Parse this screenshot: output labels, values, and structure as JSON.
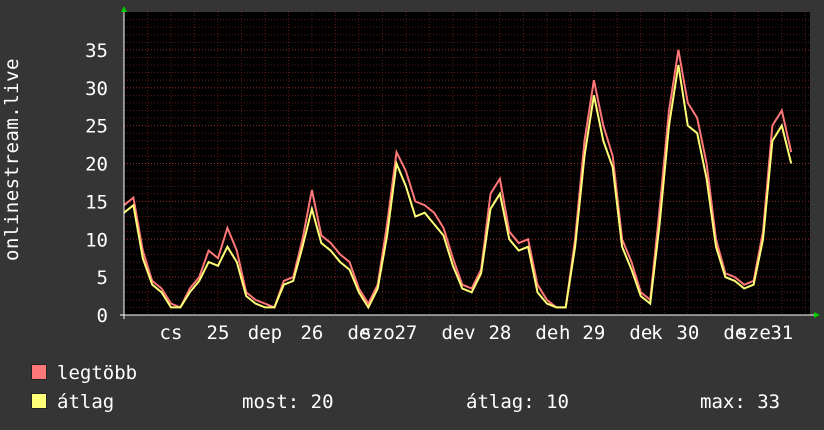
{
  "colors": {
    "background": "#353535",
    "plot_bg": "#000000",
    "max_series": "#ff7777",
    "avg_series": "#ffff77",
    "grid": "#8a2020",
    "axis": "#ffffff"
  },
  "chart_data": {
    "type": "line",
    "ylabel": "onlinestream.live",
    "ylim": [
      0,
      40
    ],
    "yticks": [
      0,
      5,
      10,
      15,
      20,
      25,
      30,
      35
    ],
    "grid": true,
    "xticks": [
      {
        "label": "cs",
        "x": 0.5
      },
      {
        "label": "25",
        "x": 1.0
      },
      {
        "label": "dep",
        "x": 1.5
      },
      {
        "label": "26",
        "x": 2.0
      },
      {
        "label": "de",
        "x": 2.5
      },
      {
        "label": "szo",
        "x": 2.7
      },
      {
        "label": "27",
        "x": 3.0
      },
      {
        "label": "de",
        "x": 3.5
      },
      {
        "label": "v",
        "x": 3.68
      },
      {
        "label": "28",
        "x": 4.0
      },
      {
        "label": "de",
        "x": 4.5
      },
      {
        "label": "h",
        "x": 4.69
      },
      {
        "label": "29",
        "x": 5.0
      },
      {
        "label": "de",
        "x": 5.5
      },
      {
        "label": "k",
        "x": 5.67
      },
      {
        "label": "30",
        "x": 6.0
      },
      {
        "label": "de",
        "x": 6.5
      },
      {
        "label": "sze",
        "x": 6.7
      },
      {
        "label": "31",
        "x": 7.0
      }
    ],
    "x": [
      0,
      0.1,
      0.2,
      0.3,
      0.4,
      0.5,
      0.6,
      0.7,
      0.8,
      0.9,
      1.0,
      1.1,
      1.2,
      1.3,
      1.4,
      1.5,
      1.6,
      1.7,
      1.8,
      1.9,
      2.0,
      2.1,
      2.2,
      2.3,
      2.4,
      2.5,
      2.6,
      2.7,
      2.8,
      2.9,
      3.0,
      3.1,
      3.2,
      3.3,
      3.4,
      3.5,
      3.6,
      3.7,
      3.8,
      3.9,
      4.0,
      4.1,
      4.2,
      4.3,
      4.4,
      4.5,
      4.6,
      4.7,
      4.8,
      4.9,
      5.0,
      5.1,
      5.2,
      5.3,
      5.4,
      5.5,
      5.6,
      5.7,
      5.8,
      5.9,
      6.0,
      6.1,
      6.2,
      6.3,
      6.4,
      6.5,
      6.6,
      6.7,
      6.8,
      6.9,
      7.0,
      7.1
    ],
    "series": [
      {
        "name": "legtöbb",
        "values": [
          14.5,
          15.5,
          8.5,
          4.5,
          3.5,
          1.5,
          1,
          3.5,
          5,
          8.5,
          7.5,
          11.5,
          8.5,
          3,
          2,
          1.5,
          1,
          4.5,
          5,
          10,
          16.5,
          10.5,
          9.5,
          8,
          7,
          3.5,
          1.5,
          4,
          12,
          21.5,
          19,
          15,
          14.5,
          13.5,
          11.5,
          7.5,
          4,
          3.5,
          6,
          16,
          18,
          11,
          9.5,
          10,
          4,
          2,
          1,
          1,
          10,
          23,
          31,
          25,
          21,
          10,
          7,
          3,
          2,
          14,
          27,
          35,
          28,
          26,
          20,
          10,
          5.5,
          5,
          4,
          4.5,
          11,
          25,
          27,
          21.5
        ]
      },
      {
        "name": "átlag",
        "values": [
          13.5,
          14.5,
          7.5,
          4,
          3,
          1,
          1,
          3,
          4.5,
          7,
          6.5,
          9,
          7,
          2.5,
          1.5,
          1,
          1,
          4,
          4.5,
          9,
          14,
          9.5,
          8.5,
          7,
          6,
          3,
          1,
          3.5,
          10.5,
          20,
          17,
          13,
          13.5,
          12,
          10.5,
          6.5,
          3.5,
          3,
          5.5,
          14,
          16,
          10,
          8.5,
          9,
          3,
          1.5,
          1,
          1,
          9,
          21,
          29,
          23,
          19.5,
          9,
          6,
          2.5,
          1.5,
          12,
          25,
          33,
          25,
          24,
          18,
          9,
          5,
          4.5,
          3.5,
          4,
          10,
          23,
          25,
          20
        ]
      }
    ]
  },
  "legend": [
    {
      "label": "legtöbb",
      "color": "#ff7777"
    },
    {
      "label": "átlag",
      "color": "#ffff77"
    }
  ],
  "stats": {
    "now": "most: 20",
    "avg": "átlag: 10",
    "max": "max: 33"
  }
}
